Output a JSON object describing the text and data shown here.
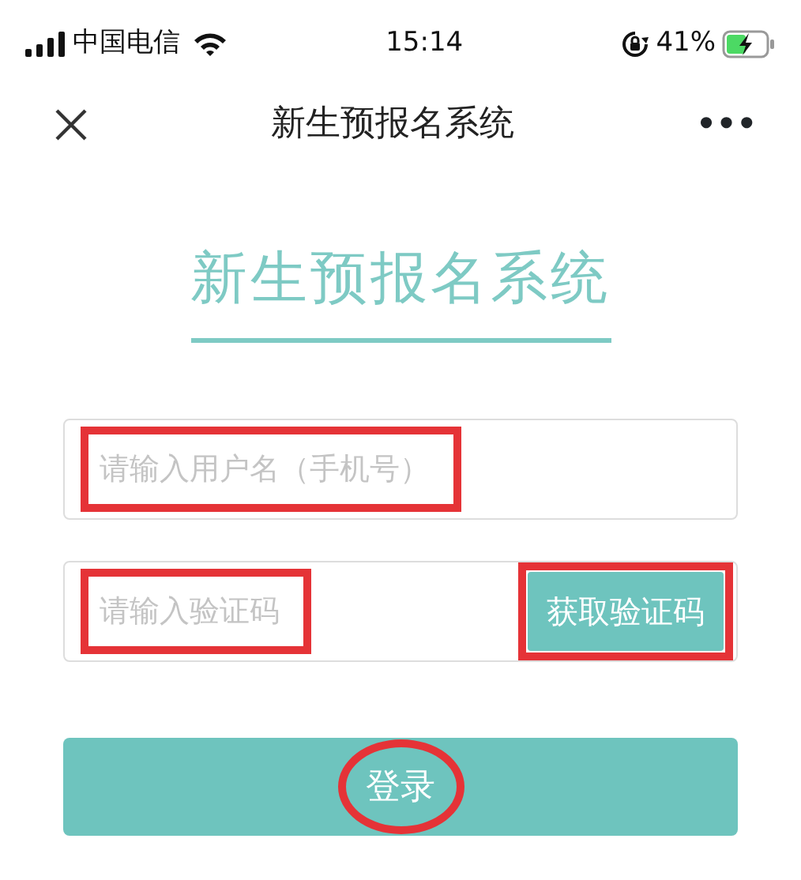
{
  "status_bar": {
    "carrier": "中国电信",
    "time": "15:14",
    "battery": "41%"
  },
  "nav_bar": {
    "title": "新生预报名系统",
    "more": "•••"
  },
  "heading": "新生预报名系统",
  "fields": [
    {
      "placeholder": "请输入用户名（手机号）",
      "highlighted": true
    },
    {
      "placeholder": "请输入验证码",
      "highlighted": true,
      "button": {
        "label": "获取验证码",
        "highlighted": true
      }
    }
  ],
  "login_button": {
    "label": "登录",
    "highlighted": true
  }
}
